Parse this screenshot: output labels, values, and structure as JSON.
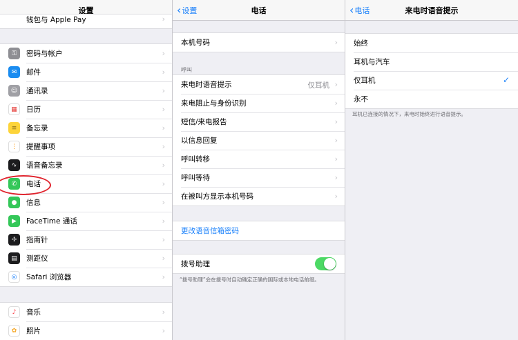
{
  "panel1": {
    "title": "设置",
    "top_item": "钱包与 Apple Pay",
    "items": [
      {
        "label": "密码与帐户",
        "icon": "key-icon",
        "color": "#8e8e93"
      },
      {
        "label": "邮件",
        "icon": "mail-icon",
        "color": "#1a8cf0"
      },
      {
        "label": "通讯录",
        "icon": "contacts-icon",
        "color": "#a0a0a5"
      },
      {
        "label": "日历",
        "icon": "calendar-icon",
        "color": "#ffffff"
      },
      {
        "label": "备忘录",
        "icon": "notes-icon",
        "color": "#fdd43a"
      },
      {
        "label": "提醒事项",
        "icon": "reminders-icon",
        "color": "#ffffff"
      },
      {
        "label": "语音备忘录",
        "icon": "voice-memos-icon",
        "color": "#1c1c1e"
      },
      {
        "label": "电话",
        "icon": "phone-icon",
        "color": "#34c759"
      },
      {
        "label": "信息",
        "icon": "messages-icon",
        "color": "#34c759"
      },
      {
        "label": "FaceTime 通话",
        "icon": "facetime-icon",
        "color": "#34c759"
      },
      {
        "label": "指南针",
        "icon": "compass-icon",
        "color": "#1c1c1e"
      },
      {
        "label": "测距仪",
        "icon": "measure-icon",
        "color": "#1c1c1e"
      },
      {
        "label": "Safari 浏览器",
        "icon": "safari-icon",
        "color": "#ffffff"
      }
    ],
    "bottom_items": [
      {
        "label": "音乐",
        "icon": "music-icon",
        "color": "#ffffff"
      },
      {
        "label": "照片",
        "icon": "photos-icon",
        "color": "#ffffff"
      }
    ]
  },
  "panel2": {
    "back": "设置",
    "title": "电话",
    "my_number": "本机号码",
    "calls_header": "呼叫",
    "calls": [
      {
        "label": "来电时语音提示",
        "value": "仅耳机"
      },
      {
        "label": "来电阻止与身份识别",
        "value": ""
      },
      {
        "label": "短信/来电报告",
        "value": ""
      },
      {
        "label": "以信息回复",
        "value": ""
      },
      {
        "label": "呼叫转移",
        "value": ""
      },
      {
        "label": "呼叫等待",
        "value": ""
      },
      {
        "label": "在被叫方显示本机号码",
        "value": ""
      }
    ],
    "change_voicemail": "更改语音信箱密码",
    "dial_assist": "拨号助理",
    "dial_assist_on": true,
    "dial_assist_note": "“拨号助理”会在拨号时自动确定正确的国际或本地电话前缀。"
  },
  "panel3": {
    "back": "电话",
    "title": "来电时语音提示",
    "options": [
      {
        "label": "始终",
        "selected": false
      },
      {
        "label": "耳机与汽车",
        "selected": false
      },
      {
        "label": "仅耳机",
        "selected": true
      },
      {
        "label": "永不",
        "selected": false
      }
    ],
    "note": "耳机已连接的情况下，来电时始终进行语音提示。"
  },
  "colors": {
    "accent": "#157efb",
    "toggle_on": "#4cd964",
    "annotation": "#e0242e"
  }
}
